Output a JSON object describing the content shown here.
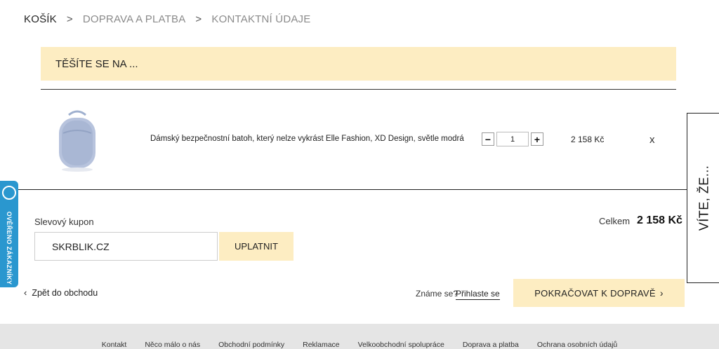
{
  "breadcrumb": {
    "step1": "KOŠÍK",
    "step2": "DOPRAVA A PLATBA",
    "step3": "KONTAKTNÍ ÚDAJE",
    "separator": ">"
  },
  "banner": {
    "text": "TĚŠÍTE SE NA ..."
  },
  "cart": {
    "item": {
      "name": "Dámský bezpečnostní batoh, který nelze vykrást Elle Fashion, XD Design, světle modrá",
      "quantity": "1",
      "price": "2 158 Kč",
      "remove": "x",
      "minus": "−",
      "plus": "+"
    }
  },
  "coupon": {
    "label": "Slevový kupon",
    "value": "SKRBLIK.CZ",
    "apply": "UPLATNIT"
  },
  "total": {
    "label": "Celkem",
    "value": "2 158 Kč"
  },
  "nav": {
    "back": "Zpět do obchodu",
    "login_question": "Známe se?",
    "login_link": "Přihlaste se",
    "continue": "POKRAČOVAT K DOPRAVĚ"
  },
  "side_tab": {
    "label": "VÍTE, ŽE..."
  },
  "verified_badge": {
    "label": "OVĚŘENO ZÁKAZNÍKY"
  },
  "footer": {
    "links": [
      "Kontakt",
      "Něco málo o nás",
      "Obchodní podmínky",
      "Reklamace",
      "Velkoobchodní spolupráce",
      "Doprava a platba",
      "Ochrana osobních údajů"
    ]
  },
  "colors": {
    "accent": "#fdedc2",
    "badge": "#2a97cf"
  }
}
